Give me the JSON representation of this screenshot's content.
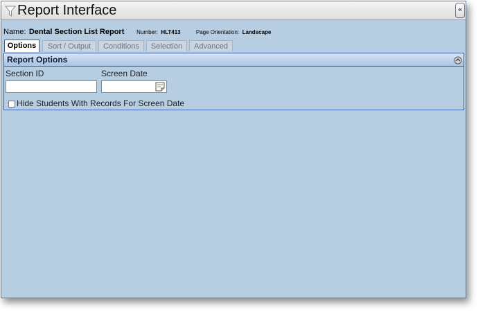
{
  "window": {
    "title": "Report Interface",
    "collapse_label": "«"
  },
  "report": {
    "name_label": "Name:",
    "name_value": "Dental Section List Report",
    "number_label": "Number:",
    "number_value": "HLT413",
    "orientation_label": "Page Orientation:",
    "orientation_value": "Landscape"
  },
  "tabs": [
    {
      "label": "Options",
      "active": true
    },
    {
      "label": "Sort / Output",
      "active": false
    },
    {
      "label": "Conditions",
      "active": false
    },
    {
      "label": "Selection",
      "active": false
    },
    {
      "label": "Advanced",
      "active": false
    }
  ],
  "options_panel": {
    "title": "Report Options",
    "section_id": {
      "label": "Section ID",
      "value": ""
    },
    "screen_date": {
      "label": "Screen Date",
      "value": ""
    },
    "hide_students": {
      "label": "Hide Students With Records For Screen Date",
      "checked": false
    }
  },
  "colors": {
    "background": "#b7cde2",
    "panel_border": "#3e62a8",
    "panel_header": "#aac4e3"
  },
  "icons": {
    "title": "filter-icon",
    "collapse": "double-chevron-left-icon",
    "panel_toggle": "circle-toggle-icon",
    "date": "calendar-icon"
  }
}
